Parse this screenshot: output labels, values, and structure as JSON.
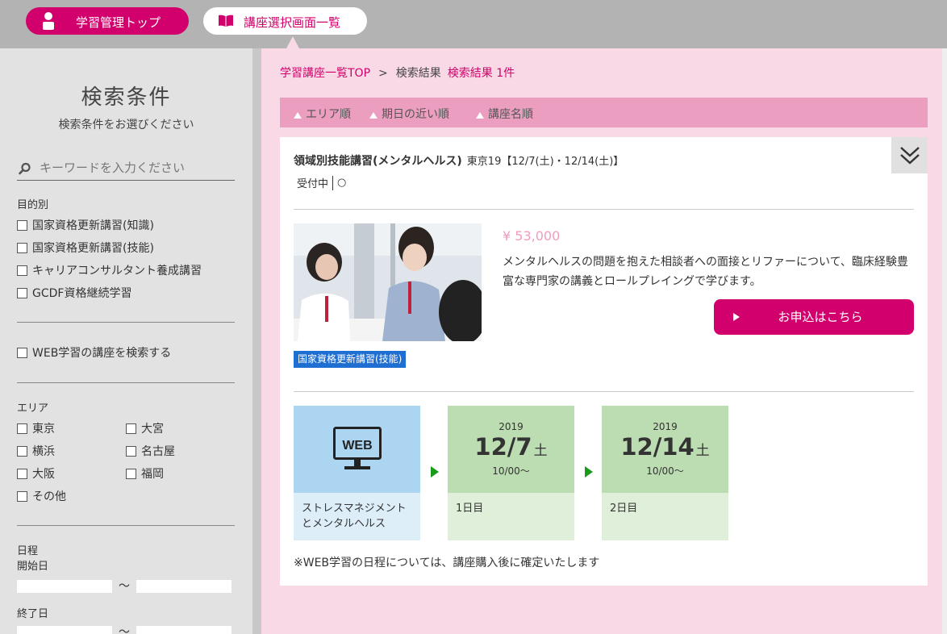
{
  "nav": {
    "top_label": "学習管理トップ",
    "list_label": "講座選択画面一覧"
  },
  "sidebar": {
    "title": "検索条件",
    "subtitle": "検索条件をお選びください",
    "search_placeholder": "キーワードを入力ください",
    "purpose_label": "目的別",
    "purpose_options": [
      "国家資格更新講習(知識)",
      "国家資格更新講習(技能)",
      "キャリアコンサルタント養成講習",
      "GCDF資格継続学習"
    ],
    "web_option": "WEB学習の講座を検索する",
    "area_label": "エリア",
    "area_options": [
      "東京",
      "大宮",
      "横浜",
      "名古屋",
      "大阪",
      "福岡",
      "その他"
    ],
    "schedule_label": "日程",
    "start_label": "開始日",
    "end_label": "終了日",
    "tilde": "〜"
  },
  "main": {
    "breadcrumb_top": "学習講座一覧TOP",
    "breadcrumb_sep": ">",
    "breadcrumb_results": "検索結果",
    "result_count": "検索結果 1件",
    "sort_options": [
      "エリア順",
      "期日の近い順",
      "講座名順"
    ],
    "course": {
      "title": "領域別技能講習(メンタルヘルス)",
      "schedule": "東京19【12/7(土)・12/14(土)】",
      "status_label": "受付中",
      "status_mark": "○",
      "price": "¥ 53,000",
      "description": "メンタルヘルスの問題を抱えた相談者への面接とリファーについて、臨床経験豊富な専門家の講義とロールプレイングで学びます。",
      "apply_label": "お申込はこちら",
      "category": "国家資格更新講習(技能)",
      "web_step": {
        "icon_text": "WEB",
        "caption": "ストレスマネジメントとメンタルヘルス"
      },
      "days": [
        {
          "year": "2019",
          "date": "12/7",
          "dow": "土",
          "time": "10/00〜",
          "caption": "1日目"
        },
        {
          "year": "2019",
          "date": "12/14",
          "dow": "土",
          "time": "10/00〜",
          "caption": "2日目"
        }
      ],
      "note": "※WEB学習の日程については、講座購入後に確定いたします"
    }
  },
  "colors": {
    "accent": "#d1006c",
    "badge": "#1f6fd2",
    "web_step": "#acd5f2",
    "day_step": "#bcdcb2"
  }
}
